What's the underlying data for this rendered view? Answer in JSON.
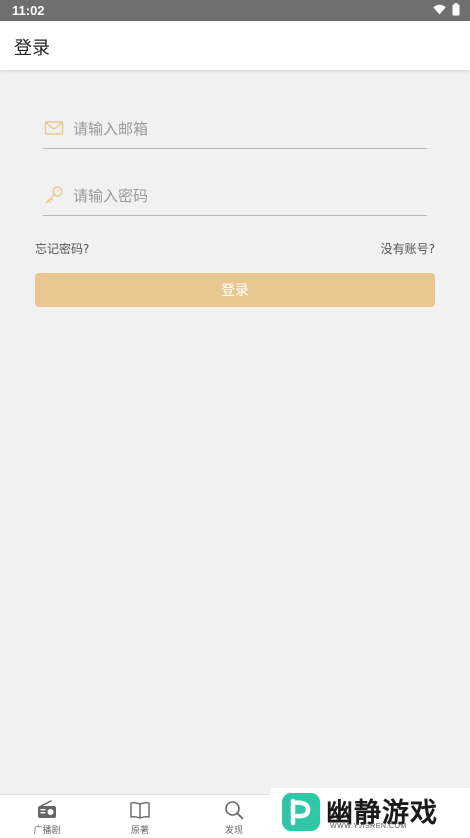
{
  "status_bar": {
    "time": "11:02"
  },
  "app_bar": {
    "title": "登录"
  },
  "form": {
    "email": {
      "placeholder": "请输入邮箱",
      "value": "",
      "icon": "mail-icon"
    },
    "password": {
      "placeholder": "请输入密码",
      "value": "",
      "icon": "key-icon"
    },
    "forgot_label": "忘记密码?",
    "register_label": "没有账号?",
    "login_label": "登录"
  },
  "bottom_nav": {
    "items": [
      {
        "label": "广播剧",
        "icon": "radio-icon"
      },
      {
        "label": "原著",
        "icon": "book-icon"
      },
      {
        "label": "发现",
        "icon": "search-icon"
      }
    ]
  },
  "watermark": {
    "text": "幽静游戏",
    "url": "WWW.YJISREN.COM"
  },
  "colors": {
    "accent": "#e8c88f",
    "status_bar": "#6f6f6f",
    "background": "#f1f1f1",
    "brand_green": "#2fc7a5"
  }
}
